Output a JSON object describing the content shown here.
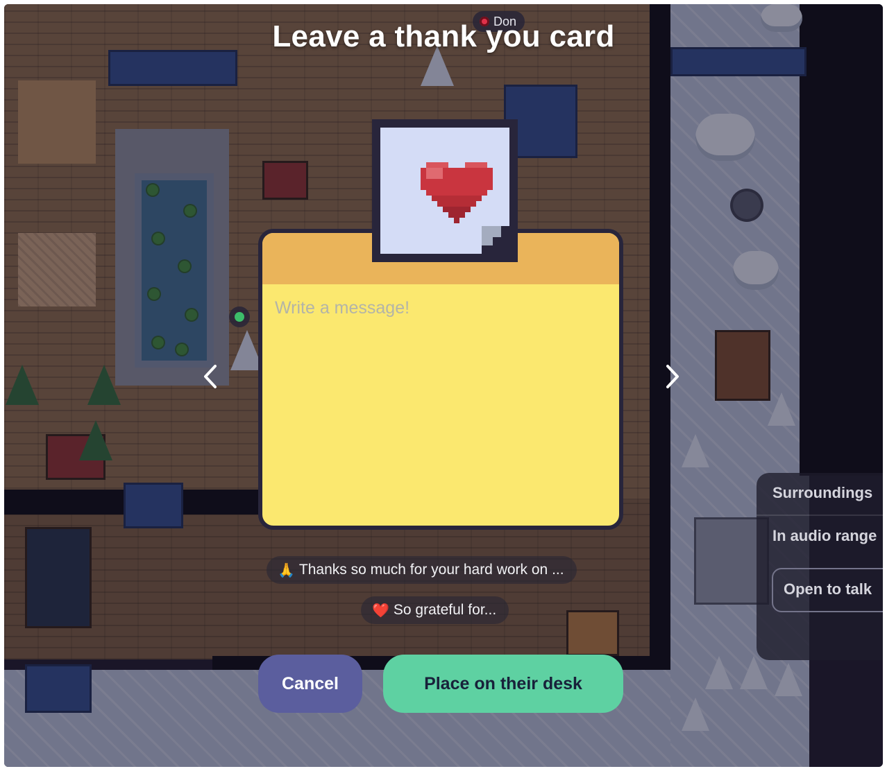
{
  "modal": {
    "title": "Leave a thank you card",
    "message_placeholder": "Write a message!",
    "prev_label": "‹",
    "next_label": "›"
  },
  "players": [
    {
      "name": "Don",
      "status_color": "#e0314a"
    }
  ],
  "suggestions": [
    {
      "emoji": "🙏",
      "text": "Thanks so much for your hard work on ..."
    },
    {
      "emoji": "❤️",
      "text": "So grateful for..."
    }
  ],
  "buttons": {
    "cancel": "Cancel",
    "place": "Place on their desk"
  },
  "side_panel": {
    "surroundings": "Surroundings",
    "audio_range": "In audio range",
    "open_to_talk": "Open to talk"
  },
  "colors": {
    "card_body": "#fbe86f",
    "card_header": "#eab45a",
    "cancel_button": "#5b5e9e",
    "place_button": "#5ed1a2",
    "heart": "#c9353f"
  }
}
